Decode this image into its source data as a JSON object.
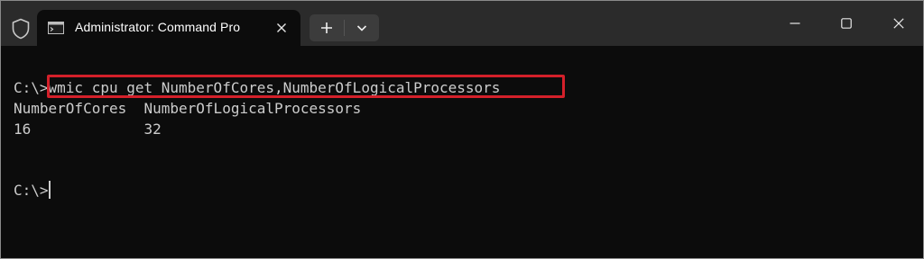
{
  "titlebar": {
    "tab_title": "Administrator: Command Pro",
    "icons": {
      "shield": "shield-icon",
      "tab": "command-prompt-icon",
      "close_tab": "close-icon",
      "new_tab": "plus-icon",
      "dropdown": "chevron-down-icon",
      "minimize": "minimize-icon",
      "maximize": "maximize-icon",
      "close": "close-icon"
    }
  },
  "terminal": {
    "prompt": "C:\\>",
    "command": "wmic cpu get NumberOfCores,NumberOfLogicalProcessors",
    "output_header": "NumberOfCores  NumberOfLogicalProcessors",
    "output_values": "16             32",
    "prompt2": "C:\\>",
    "highlight_color": "#d4202a"
  }
}
